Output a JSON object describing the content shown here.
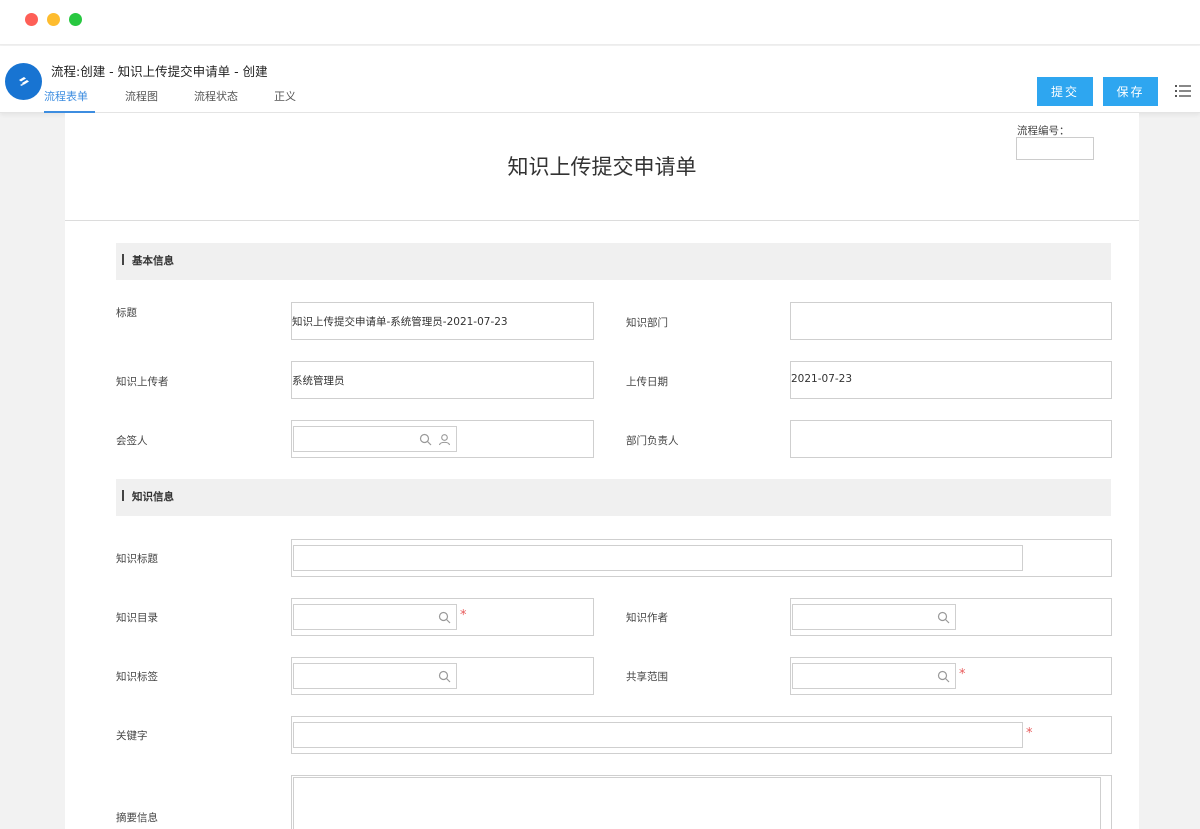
{
  "header": {
    "title": "流程:创建 - 知识上传提交申请单 - 创建",
    "tabs": [
      "流程表单",
      "流程图",
      "流程状态",
      "正义"
    ],
    "submit_label": "提交",
    "save_label": "保存"
  },
  "form": {
    "doc_title": "知识上传提交申请单",
    "flow_no_label": "流程编号："
  },
  "basic": {
    "section_title": "基本信息",
    "title_label": "标题",
    "title_value": "知识上传提交申请单-系统管理员-2021-07-23",
    "dept_label": "知识部门",
    "dept_value": "",
    "uploader_label": "知识上传者",
    "uploader_value": "系统管理员",
    "upload_date_label": "上传日期",
    "upload_date_value": "2021-07-23",
    "countersign_label": "会签人",
    "dept_head_label": "部门负责人"
  },
  "knowledge": {
    "section_title": "知识信息",
    "kn_title_label": "知识标题",
    "catalog_label": "知识目录",
    "author_label": "知识作者",
    "tags_label": "知识标签",
    "share_label": "共享范围",
    "keyword_label": "关键字",
    "summary_label": "摘要信息",
    "required_mark": "*"
  },
  "colors": {
    "accent": "#2ea6f0",
    "tab_active": "#3d8de0",
    "required": "#e85a5a",
    "logo": "#1874d2"
  }
}
